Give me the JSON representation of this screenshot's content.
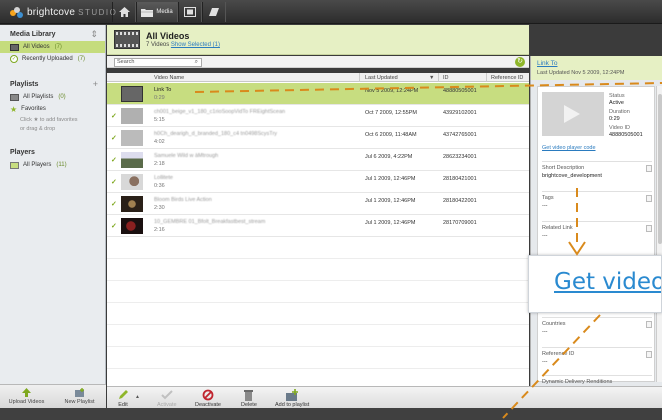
{
  "app": {
    "logo_brand": "brightcove",
    "logo_product": "STUDIO",
    "nav": [
      {
        "label": "",
        "icon": "home-icon"
      },
      {
        "label": "Media",
        "icon": "folder-icon"
      },
      {
        "label": "",
        "icon": "player-icon"
      },
      {
        "label": "",
        "icon": "publish-icon"
      }
    ]
  },
  "sidebar": {
    "media_library": {
      "title": "Media Library",
      "items": [
        {
          "label": "All Videos",
          "count": "(7)"
        },
        {
          "label": "Recently Uploaded",
          "count": "(7)"
        }
      ]
    },
    "playlists": {
      "title": "Playlists",
      "items": [
        {
          "label": "All Playlists",
          "count": "(0)"
        },
        {
          "label": "Favorites",
          "count": ""
        }
      ],
      "hint_line1": "Click ★ to add favorites",
      "hint_line2": "or drag & drop"
    },
    "players": {
      "title": "Players",
      "items": [
        {
          "label": "All Players",
          "count": "(11)"
        }
      ]
    },
    "footer": {
      "upload_label": "Upload Videos",
      "new_playlist_label": "New Playlist"
    }
  },
  "main": {
    "title": "All Videos",
    "count_text": "7 Videos",
    "show_selected": "Show Selected (1)",
    "search_placeholder": "Search",
    "columns": {
      "name": "Video Name",
      "updated": "Last Updated",
      "id": "ID",
      "ref": "Reference ID"
    },
    "rows": [
      {
        "name": "Link To",
        "duration": "0:29",
        "updated": "Nov 5 2009, 12:24PM",
        "id": "48880505001",
        "selected": true
      },
      {
        "name": "ch001_beige_v1_180_c1rioSoopVidTo FREightScean",
        "duration": "5:15",
        "updated": "Oct 7 2009, 12:55PM",
        "id": "43929102001",
        "selected": false
      },
      {
        "name": "h0Ch_dearigh_d_branded_180_c4 tn0498ScysTry",
        "duration": "4:02",
        "updated": "Oct 6 2009, 11:48AM",
        "id": "43742765001",
        "selected": false
      },
      {
        "name": "Samuele Wild w àMtrough",
        "duration": "2:18",
        "updated": "Jul 6 2009, 4:22PM",
        "id": "28623234001",
        "selected": false
      },
      {
        "name": "Lollitete",
        "duration": "0:36",
        "updated": "Jul 1 2009, 12:46PM",
        "id": "28180421001",
        "selected": false
      },
      {
        "name": "Bloom Birds Live Action",
        "duration": "2:30",
        "updated": "Jul 1 2009, 12:46PM",
        "id": "28180422001",
        "selected": false
      },
      {
        "name": "10_GEMBRE 01_Bfolt_Breakfastbest_stream",
        "duration": "2:16",
        "updated": "Jul 1 2009, 12:46PM",
        "id": "28170709001",
        "selected": false
      }
    ]
  },
  "toolbar": {
    "edit": "Edit",
    "activate": "Activate",
    "deactivate": "Deactivate",
    "delete": "Delete",
    "add_to_playlist": "Add to playlist"
  },
  "detail": {
    "title": "Link To",
    "last_updated": "Last Updated Nov 5 2009, 12:24PM",
    "status_label": "Status",
    "status_value": "Active",
    "duration_label": "Duration",
    "duration_value": "0:29",
    "video_id_label": "Video ID",
    "video_id_value": "48880505001",
    "player_code_link": "Get video player code",
    "short_desc_label": "Short Description",
    "short_desc_value": "brightcove_development",
    "tags_label": "Tags",
    "tags_value": "---",
    "related_label": "Related Link",
    "related_value": "---",
    "countries_label": "Countries",
    "countries_value": "---",
    "ref_label": "Reference ID",
    "ref_value": "---",
    "ddr_label": "Dynamic Delivery Renditions"
  },
  "zoom_callout": {
    "text": "Get video"
  },
  "colors": {
    "selection_green": "#c7dd80",
    "header_green": "#e6f0c4",
    "link_blue": "#2a7bbf",
    "arrow_orange": "#d98a1c"
  }
}
